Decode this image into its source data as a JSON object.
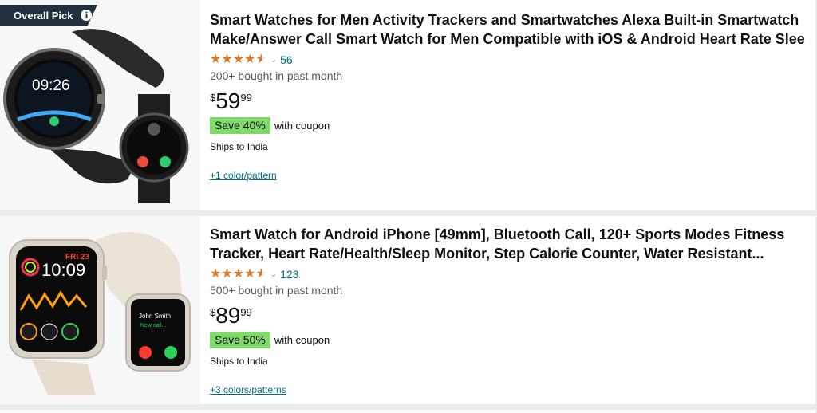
{
  "colors": {
    "background": "#eaeded",
    "badge_bg": "#232f3e",
    "star": "#de7921",
    "link": "#007185",
    "save_badge": "#7fda69"
  },
  "products": [
    {
      "badge": "Overall Pick",
      "badge_icon": "info-icon",
      "title_line1": "Smart Watches for Men Activity Trackers and Smartwatches Alexa Built-in Smartwatch",
      "title_line2": "Make/Answer Call Smart Watch for Men Compatible with iOS & Android Heart Rate Slee...",
      "rating": 4.5,
      "review_count": "56",
      "bought": "200+ bought in past month",
      "price_symbol": "$",
      "price_whole": "59",
      "price_fraction": "99",
      "save_label": "Save 40%",
      "coupon_text": "with coupon",
      "ships": "Ships to India",
      "colors_link": "+1 color/pattern",
      "watch_time": "09:26"
    },
    {
      "title_line1": "Smart Watch for Android iPhone [49mm], Bluetooth Call, 120+ Sports Modes Fitness",
      "title_line2": "Tracker, Heart Rate/Health/Sleep Monitor, Step Calorie Counter, Water Resistant...",
      "rating": 4.5,
      "review_count": "123",
      "bought": "500+ bought in past month",
      "price_symbol": "$",
      "price_whole": "89",
      "price_fraction": "99",
      "save_label": "Save 50%",
      "coupon_text": "with coupon",
      "ships": "Ships to India",
      "colors_link": "+3 colors/patterns",
      "watch_time": "10:09",
      "watch_date": "FRI 23",
      "caller": "John Smith",
      "call_status": "New call..."
    }
  ]
}
